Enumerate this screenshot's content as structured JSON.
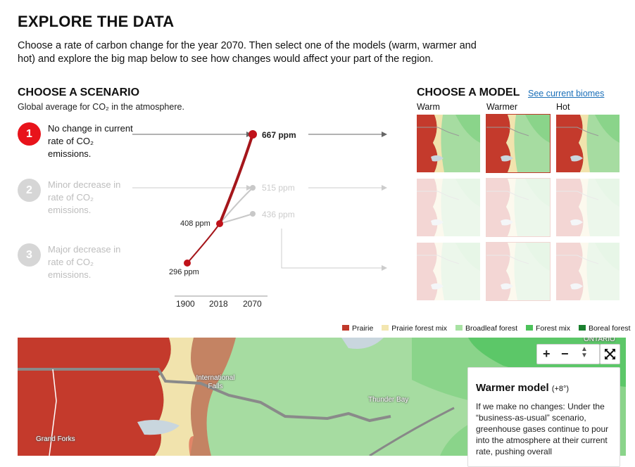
{
  "header": {
    "title": "EXPLORE THE DATA",
    "intro": "Choose a rate of carbon change for the year 2070. Then select one of the models (warm, warmer and hot) and explore the big map below to see how changes would affect your part of the region."
  },
  "scenario": {
    "title": "CHOOSE A SCENARIO",
    "subtitle": "Global average for CO₂ in the atmosphere.",
    "items": [
      {
        "number": "1",
        "label": "No change in current rate of CO₂ emissions.",
        "active": true
      },
      {
        "number": "2",
        "label": "Minor decrease in rate of CO₂ emissions.",
        "active": false
      },
      {
        "number": "3",
        "label": "Major decrease in rate of CO₂ emissions.",
        "active": false
      }
    ],
    "chart": {
      "points": [
        {
          "year": "1900",
          "label": "296 ppm"
        },
        {
          "year": "2018",
          "label": "408 ppm"
        }
      ],
      "endpoints": [
        "667 ppm",
        "515 ppm",
        "436 ppm"
      ],
      "years": [
        "1900",
        "2018",
        "2070"
      ]
    }
  },
  "model": {
    "title": "CHOOSE A MODEL",
    "link": "See current biomes",
    "columns": [
      "Warm",
      "Warmer",
      "Hot"
    ],
    "selected_column": "Warmer"
  },
  "legend": [
    {
      "label": "Prairie",
      "color": "#c0392b"
    },
    {
      "label": "Prairie forest mix",
      "color": "#f3e6b0"
    },
    {
      "label": "Broadleaf forest",
      "color": "#a8e2a3"
    },
    {
      "label": "Forest mix",
      "color": "#4cc25a"
    },
    {
      "label": "Boreal forest",
      "color": "#1a7f2e"
    }
  ],
  "map": {
    "labels": {
      "intl_falls": "International Falls",
      "thunder_bay": "Thunder Bay",
      "grand_forks": "Grand Forks",
      "ontario": "ONTARIO"
    },
    "controls": {
      "zoom_in": "+",
      "zoom_out": "−",
      "fullscreen_icon": "expand-icon"
    }
  },
  "info_panel": {
    "title": "Warmer model",
    "suffix": "(+8°)",
    "body": "If we make no changes: Under the “business-as-usual” scenario, greenhouse gases continue to pour into the atmosphere at their current rate, pushing overall"
  }
}
